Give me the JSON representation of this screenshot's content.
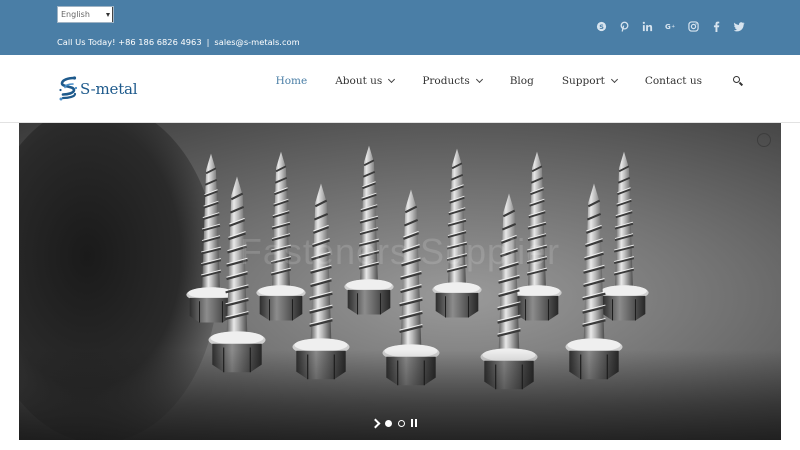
{
  "topbar": {
    "language": "English",
    "contact_prefix": "Call Us Today! +86 186 6826 4963",
    "separator": "|",
    "email": "sales@s-metals.com",
    "background": "#4a7ea6",
    "socials": [
      "skype-icon",
      "pinterest-icon",
      "linkedin-icon",
      "google-plus-icon",
      "instagram-icon",
      "facebook-icon",
      "twitter-icon"
    ]
  },
  "logo": {
    "text": "S-metal",
    "color": "#1e5a8c"
  },
  "nav": {
    "items": [
      {
        "label": "Home",
        "active": true
      },
      {
        "label": "About us",
        "dropdown": true
      },
      {
        "label": "Products",
        "dropdown": true
      },
      {
        "label": "Blog"
      },
      {
        "label": "Support",
        "dropdown": true
      },
      {
        "label": "Contact us"
      }
    ],
    "active_color": "#4a7ea6"
  },
  "hero": {
    "headline": "Fasteners Supplier",
    "slides": 2,
    "active_slide": 1
  }
}
